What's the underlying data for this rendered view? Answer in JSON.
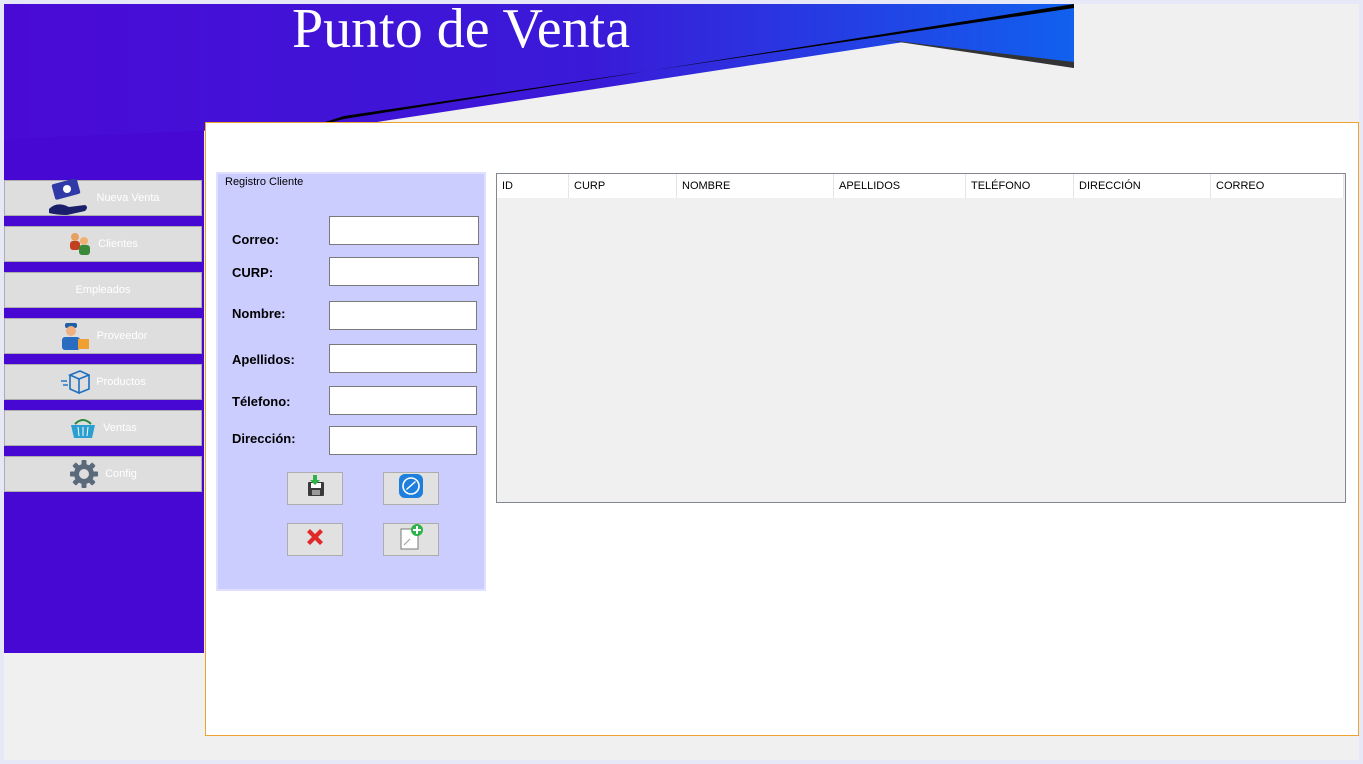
{
  "header": {
    "title": "Punto de Venta"
  },
  "sidebar": {
    "items": [
      {
        "label": "Nueva Venta",
        "icon": "hand-money-icon"
      },
      {
        "label": "Clientes",
        "icon": "clients-icon"
      },
      {
        "label": "Empleados",
        "icon": ""
      },
      {
        "label": "Proveedor",
        "icon": "delivery-man-icon"
      },
      {
        "label": "Productos",
        "icon": "box-icon"
      },
      {
        "label": "Ventas",
        "icon": "basket-icon"
      },
      {
        "label": "Config",
        "icon": "gear-icon"
      }
    ]
  },
  "form": {
    "title": "Registro Cliente",
    "fields": {
      "correo": {
        "label": "Correo:",
        "value": ""
      },
      "curp": {
        "label": "CURP:",
        "value": ""
      },
      "nombre": {
        "label": "Nombre:",
        "value": ""
      },
      "apellidos": {
        "label": "Apellidos:",
        "value": ""
      },
      "telefono": {
        "label": "Télefono:",
        "value": ""
      },
      "direccion": {
        "label": "Dirección:",
        "value": ""
      }
    },
    "buttons": [
      "save-icon",
      "edit-icon",
      "delete-icon",
      "new-document-icon"
    ]
  },
  "table": {
    "columns": [
      "ID",
      "CURP",
      "NOMBRE",
      "APELLIDOS",
      "TELÉFONO",
      "DIRECCIÓN",
      "CORREO"
    ],
    "rows": []
  },
  "colors": {
    "sidebar": "#4608d2",
    "banner_start": "#4a0ad6",
    "banner_end": "#1160ee",
    "panel_border": "#f0a22e",
    "form_bg": "#cccdff"
  }
}
